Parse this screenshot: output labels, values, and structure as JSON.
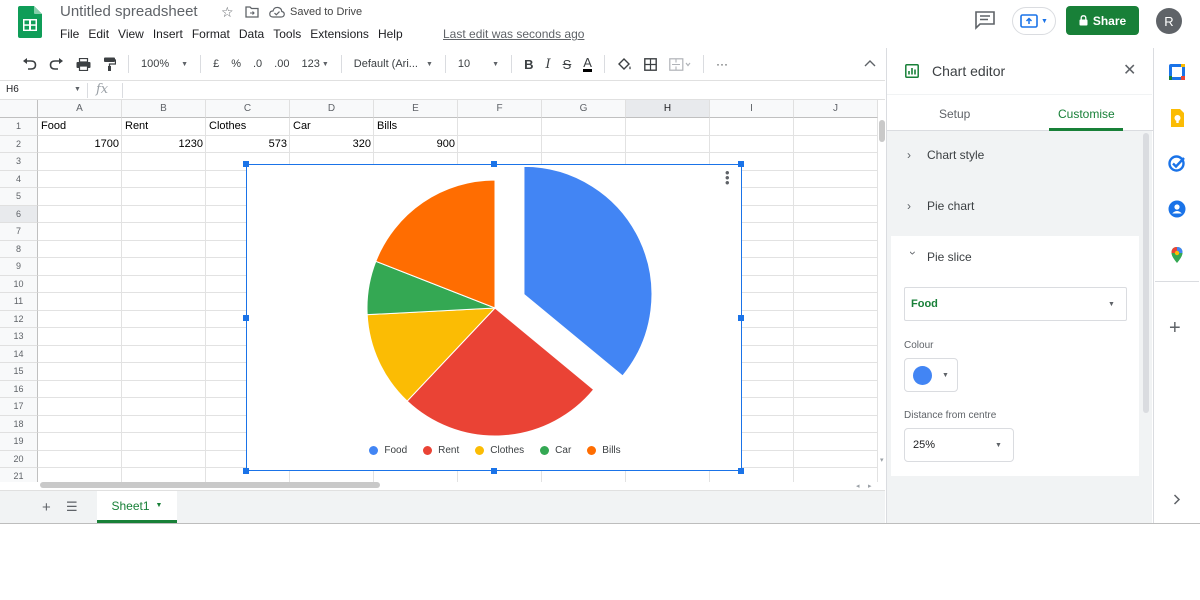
{
  "app": {
    "doc_title": "Untitled spreadsheet",
    "saved_status": "Saved to Drive",
    "last_edit": "Last edit was seconds ago",
    "menu": [
      "File",
      "Edit",
      "View",
      "Insert",
      "Format",
      "Data",
      "Tools",
      "Extensions",
      "Help"
    ],
    "share_label": "Share",
    "avatar_initial": "R"
  },
  "toolbar": {
    "zoom": "100%",
    "currency": "£",
    "percent": "%",
    "decrease_decimal": ".0",
    "increase_decimal": ".00",
    "format_more": "123",
    "font": "Default (Ari...",
    "font_size": "10",
    "bold": "B",
    "italic": "I",
    "strike": "S",
    "text_color": "A",
    "more": "···"
  },
  "formula_bar": {
    "namebox": "H6",
    "fx": "fx",
    "value": ""
  },
  "grid": {
    "columns": [
      "A",
      "B",
      "C",
      "D",
      "E",
      "F",
      "G",
      "H",
      "I",
      "J"
    ],
    "selected_column": "H",
    "rows": [
      "1",
      "2",
      "3",
      "4",
      "5",
      "6",
      "7",
      "8",
      "9",
      "10",
      "11",
      "12",
      "13",
      "14",
      "15",
      "16",
      "17",
      "18",
      "19",
      "20",
      "21"
    ],
    "selected_row": "6",
    "row1": [
      "Food",
      "Rent",
      "Clothes",
      "Car",
      "Bills"
    ],
    "row2": [
      "1700",
      "1230",
      "573",
      "320",
      "900"
    ]
  },
  "chart_data": {
    "type": "pie",
    "categories": [
      "Food",
      "Rent",
      "Clothes",
      "Car",
      "Bills"
    ],
    "values": [
      1700,
      1230,
      573,
      320,
      900
    ],
    "colors": [
      "#4285f4",
      "#ea4335",
      "#fbbc04",
      "#34a853",
      "#ff6d01"
    ],
    "exploded": {
      "category": "Food",
      "distance_from_centre": "25%"
    },
    "legend": "bottom",
    "title": ""
  },
  "sheet_tabs": {
    "active": "Sheet1"
  },
  "chart_editor": {
    "title": "Chart editor",
    "tabs": {
      "setup": "Setup",
      "customise": "Customise"
    },
    "sections": {
      "chart_style": "Chart style",
      "pie_chart": "Pie chart",
      "pie_slice": "Pie slice"
    },
    "pie_slice": {
      "selected_slice": "Food",
      "colour_label": "Colour",
      "colour_value": "#4285f4",
      "distance_label": "Distance from centre",
      "distance_value": "25%"
    }
  }
}
